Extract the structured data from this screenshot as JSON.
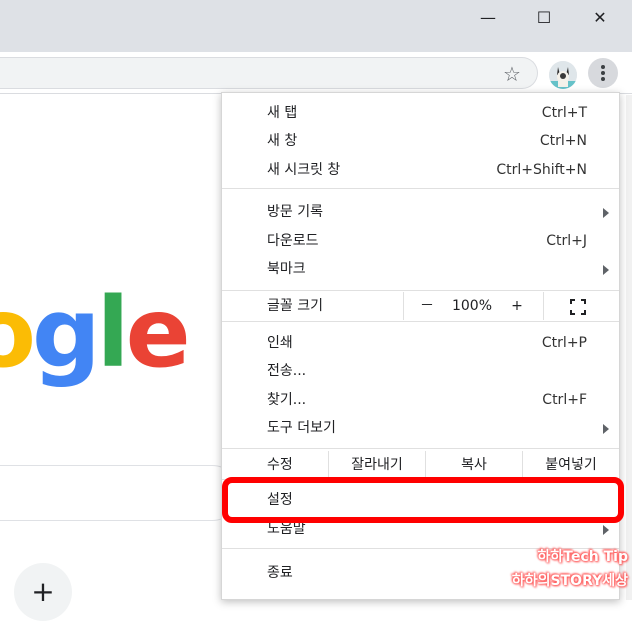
{
  "window": {
    "controls": {
      "minimize": "—",
      "maximize": "☐",
      "close": "✕"
    }
  },
  "toolbar": {
    "star_icon": "☆",
    "menu_icon": "⋮"
  },
  "page": {
    "logo_visible": "ogle",
    "add_shortcut": "+"
  },
  "menu": {
    "group1": [
      {
        "label": "새 탭",
        "shortcut": "Ctrl+T"
      },
      {
        "label": "새 창",
        "shortcut": "Ctrl+N"
      },
      {
        "label": "새 시크릿 창",
        "shortcut": "Ctrl+Shift+N"
      }
    ],
    "group2": [
      {
        "label": "방문 기록",
        "shortcut": ""
      },
      {
        "label": "다운로드",
        "shortcut": "Ctrl+J"
      },
      {
        "label": "북마크",
        "shortcut": ""
      }
    ],
    "zoom": {
      "label": "글꼴 크기",
      "minus": "－",
      "value": "100%",
      "plus": "+"
    },
    "group3": [
      {
        "label": "인쇄",
        "shortcut": "Ctrl+P"
      },
      {
        "label": "전송...",
        "shortcut": ""
      },
      {
        "label": "찾기...",
        "shortcut": "Ctrl+F"
      },
      {
        "label": "도구 더보기",
        "shortcut": ""
      }
    ],
    "edit": {
      "label": "수정",
      "cut": "잘라내기",
      "copy": "복사",
      "paste": "붙여넣기"
    },
    "settings": "설정",
    "help": "도움말",
    "exit": "종료"
  },
  "watermark": {
    "line1": "하하Tech Tip",
    "line2": "하하의STORY세상"
  },
  "colors": {
    "highlight": "#ff0000",
    "logo_o": "#fbbc05",
    "logo_g": "#4285f4",
    "logo_l": "#34a853",
    "logo_e": "#ea4335"
  }
}
